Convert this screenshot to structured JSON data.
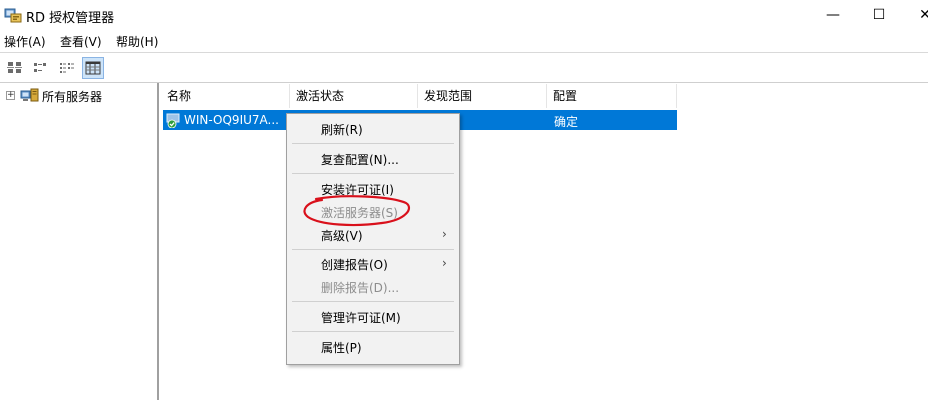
{
  "window": {
    "title": "RD 授权管理器",
    "controls": {
      "minimize": "—",
      "maximize": "☐",
      "close": "✕"
    }
  },
  "menubar": {
    "items": [
      {
        "label": "操作(A)"
      },
      {
        "label": "查看(V)"
      },
      {
        "label": "帮助(H)"
      }
    ]
  },
  "toolbar": {
    "buttons": [
      {
        "icon": "large-icons-view-icon",
        "active": false
      },
      {
        "icon": "small-icons-view-icon",
        "active": false
      },
      {
        "icon": "list-view-icon",
        "active": false
      },
      {
        "icon": "details-view-icon",
        "active": true
      }
    ]
  },
  "tree": {
    "root": {
      "label": "所有服务器",
      "expander": "+",
      "icon": "servers-icon"
    }
  },
  "list": {
    "columns": [
      "名称",
      "激活状态",
      "发现范围",
      "配置"
    ],
    "rows": [
      {
        "name": "WIN-OQ9IU7A...",
        "activation": "",
        "scope": "",
        "config": "确定",
        "selected": true,
        "icon": "server-ok-icon"
      }
    ]
  },
  "context_menu": {
    "items": [
      {
        "label": "刷新(R)",
        "disabled": false,
        "submenu": false
      },
      {
        "label": "复查配置(N)...",
        "disabled": false,
        "submenu": false
      },
      {
        "label": "安装许可证(I)",
        "disabled": false,
        "submenu": false
      },
      {
        "label": "激活服务器(S)",
        "disabled": true,
        "submenu": false
      },
      {
        "label": "高级(V)",
        "disabled": false,
        "submenu": true
      },
      {
        "label": "创建报告(O)",
        "disabled": false,
        "submenu": true
      },
      {
        "label": "删除报告(D)...",
        "disabled": true,
        "submenu": false
      },
      {
        "label": "管理许可证(M)",
        "disabled": false,
        "submenu": false
      },
      {
        "label": "属性(P)",
        "disabled": false,
        "submenu": false
      }
    ],
    "submenu_arrow": "›"
  },
  "colors": {
    "selection": "#0078d7",
    "annotation": "#d9101b",
    "disabled_text": "#8d8d8d"
  }
}
